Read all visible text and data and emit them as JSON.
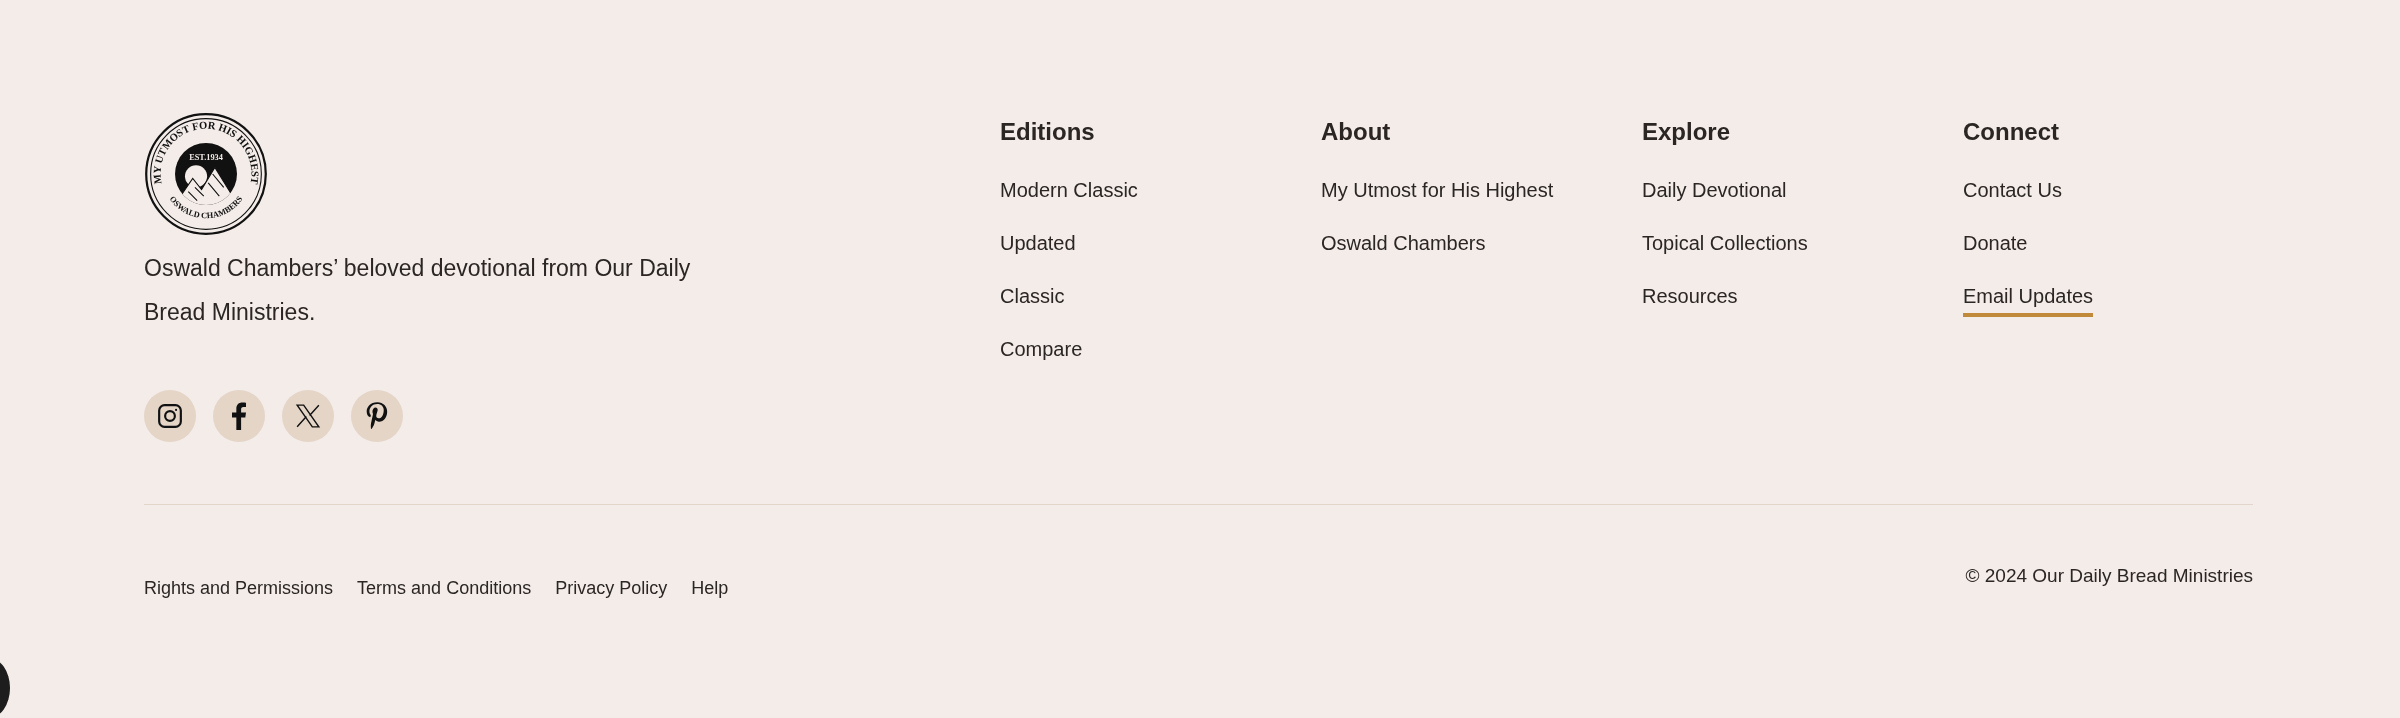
{
  "brand": {
    "logo": {
      "ring_text": "MY UTMOST FOR HIS HIGHEST",
      "est": "EST.1934",
      "bottom_text": "OSWALD CHAMBERS"
    },
    "description": "Oswald Chambers’ beloved devotional from Our Daily Bread Ministries.",
    "social": [
      {
        "kind": "instagram"
      },
      {
        "kind": "facebook"
      },
      {
        "kind": "x"
      },
      {
        "kind": "pinterest"
      }
    ]
  },
  "columns": [
    {
      "heading": "Editions",
      "links": [
        {
          "label": "Modern Classic",
          "selected": false
        },
        {
          "label": "Updated",
          "selected": false
        },
        {
          "label": "Classic",
          "selected": false
        },
        {
          "label": "Compare",
          "selected": false
        }
      ]
    },
    {
      "heading": "About",
      "links": [
        {
          "label": "My Utmost for His Highest",
          "selected": false
        },
        {
          "label": "Oswald Chambers",
          "selected": false
        }
      ]
    },
    {
      "heading": "Explore",
      "links": [
        {
          "label": "Daily Devotional",
          "selected": false
        },
        {
          "label": "Topical Collections",
          "selected": false
        },
        {
          "label": "Resources",
          "selected": false
        }
      ]
    },
    {
      "heading": "Connect",
      "links": [
        {
          "label": "Contact Us",
          "selected": false
        },
        {
          "label": "Donate",
          "selected": false
        },
        {
          "label": "Email Updates",
          "selected": true
        }
      ]
    }
  ],
  "legal_links": [
    "Rights and Permissions",
    "Terms and Conditions",
    "Privacy Policy",
    "Help"
  ],
  "copyright": "© 2024 Our Daily Bread Ministries"
}
